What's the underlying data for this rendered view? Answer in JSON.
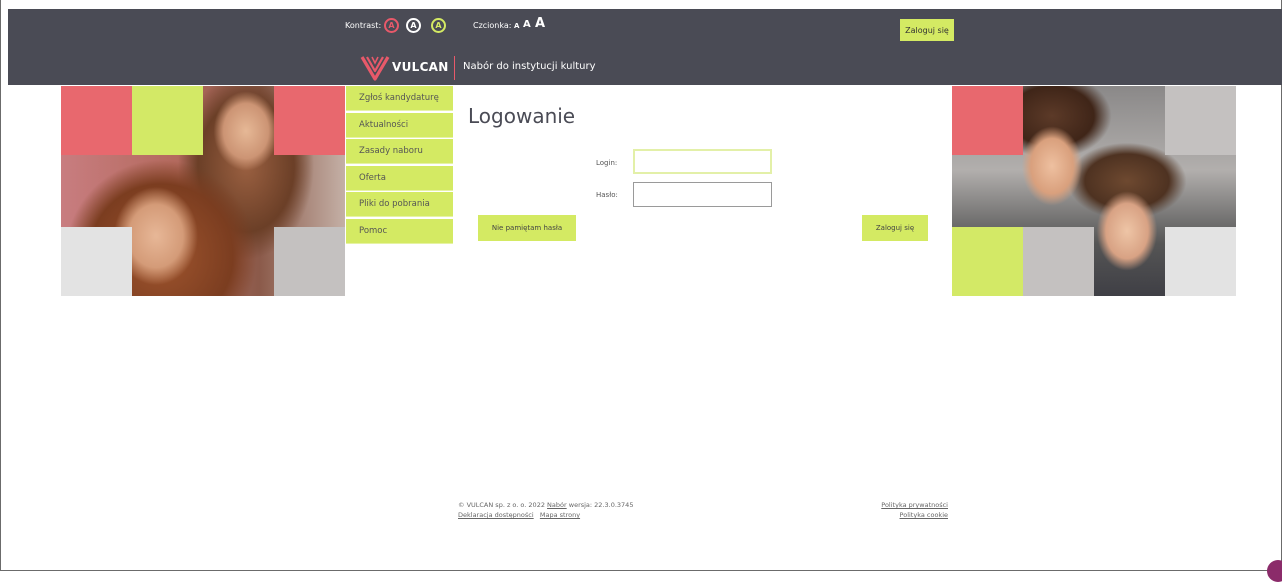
{
  "toolbar": {
    "contrast_label": "Kontrast:",
    "contrast_options": [
      "A",
      "A",
      "A"
    ],
    "font_label": "Czcionka:",
    "font_sizes": [
      "A",
      "A",
      "A"
    ],
    "login_button": "Zaloguj się"
  },
  "brand": {
    "logo_text": "VULCAN",
    "app_title": "Nabór do instytucji kultury"
  },
  "menu": {
    "items": [
      {
        "label": "Zgłoś kandydaturę"
      },
      {
        "label": "Aktualności"
      },
      {
        "label": "Zasady naboru"
      },
      {
        "label": "Oferta"
      },
      {
        "label": "Pliki do pobrania"
      },
      {
        "label": "Pomoc"
      }
    ]
  },
  "login_form": {
    "title": "Logowanie",
    "login_label": "Login:",
    "login_value": "",
    "password_label": "Hasło:",
    "password_value": "",
    "forgot_button": "Nie pamiętam hasła",
    "submit_button": "Zaloguj się"
  },
  "footer": {
    "copyright": "© VULCAN sp. z o. o. 2022",
    "nabor_link": "Nabór",
    "version": "wersja: 22.3.0.3745",
    "accessibility_link": "Deklaracja dostępności",
    "sitemap_link": "Mapa strony",
    "privacy_link": "Polityka prywatności",
    "cookie_link": "Polityka cookie"
  },
  "colors": {
    "accent_lime": "#d4ea63",
    "accent_red": "#e8596a",
    "topbar": "#4a4b55"
  }
}
